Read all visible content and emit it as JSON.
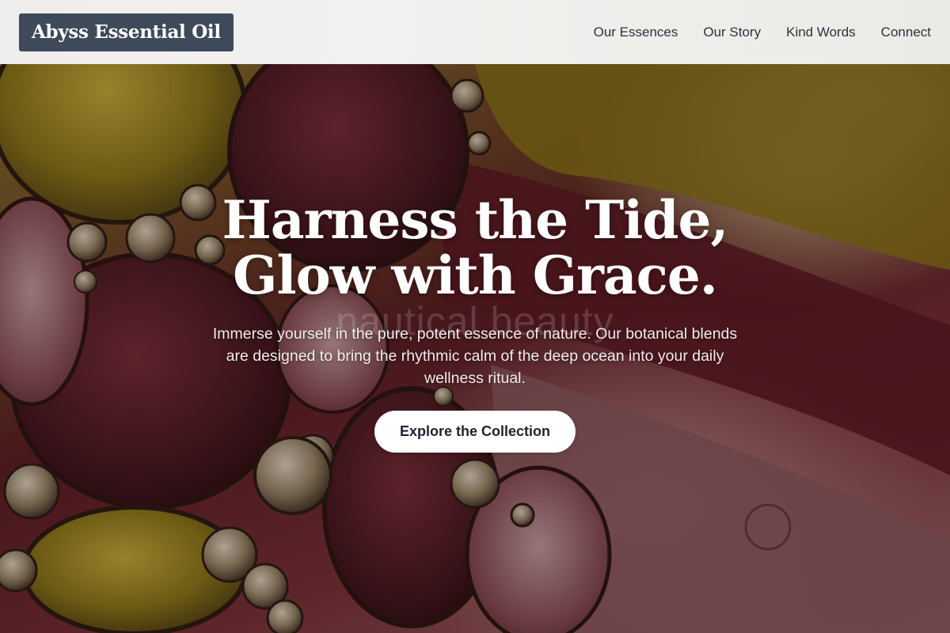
{
  "header": {
    "logo_text": "Abyss Essential Oil",
    "nav": [
      {
        "label": "Our Essences"
      },
      {
        "label": "Our Story"
      },
      {
        "label": "Kind Words"
      },
      {
        "label": "Connect"
      }
    ]
  },
  "hero": {
    "title_line1": "Harness the Tide,",
    "title_line2": "Glow with Grace.",
    "ghost_text": "nautical beauty",
    "subtitle": "Immerse yourself in the pure, potent essence of nature. Our botanical blends are designed to bring the rhythmic calm of the deep ocean into your daily wellness ritual.",
    "cta_label": "Explore the Collection"
  },
  "colors": {
    "logo_bg": "#3e4a5a",
    "header_bg": "#f0efed",
    "cta_bg": "#ffffff",
    "cta_text": "#1d2330"
  }
}
